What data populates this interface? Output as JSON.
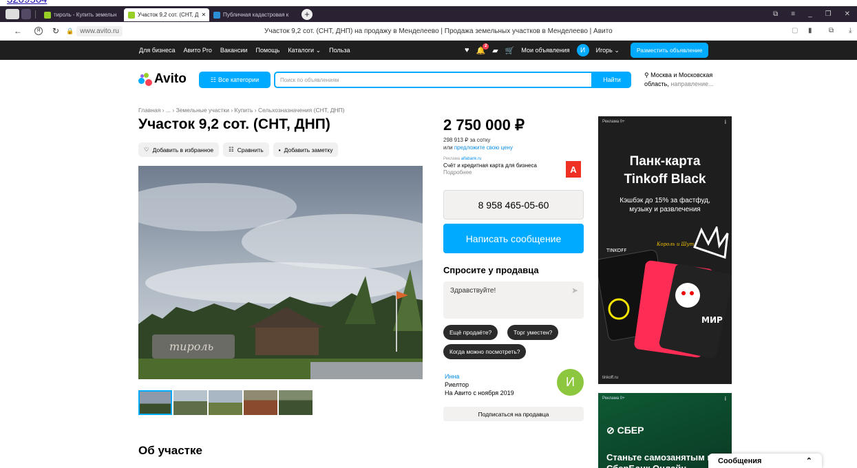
{
  "page_link": "3209564",
  "browser": {
    "tabs": [
      {
        "label": "тироль - Купить земельн",
        "active": false
      },
      {
        "label": "Участок 9,2 сот. (СНТ, Д",
        "active": true
      },
      {
        "label": "Публичная кадастровая к",
        "active": false
      }
    ],
    "url": "www.avito.ru",
    "page_title": "Участок 9,2 сот. (СНТ, ДНП) на продажу в Менделеево | Продажа земельных участков в Менделеево | Авито"
  },
  "site_nav": {
    "links": [
      "Для бизнеса",
      "Авито Pro",
      "Вакансии",
      "Помощь",
      "Каталоги",
      "Польза"
    ],
    "my_ads": "Мои объявления",
    "user_initial": "И",
    "user_name": "Игорь",
    "notifications_count": "2",
    "post_button": "Разместить объявление"
  },
  "header": {
    "logo": "Avito",
    "categories_button": "Все категории",
    "search_placeholder": "Поиск по объявлениям",
    "search_button": "Найти",
    "location": "Москва и Московская область,",
    "direction": "направление..."
  },
  "listing": {
    "breadcrumbs": "Главная › ... › Земельные участки › Купить › Сельхозназначения (СНТ, ДНП)",
    "title": "Участок 9,2 сот. (СНТ, ДНП)",
    "actions": [
      "Добавить в избранное",
      "Сравнить",
      "Добавить заметку"
    ],
    "section_about": "Об участке",
    "thumbnails_count": 5
  },
  "sidebar": {
    "price": "2 750 000 ₽",
    "price_per_unit": "298 913 ₽ за сотку",
    "offer_prefix": "или",
    "offer_link": "предложите свою цену",
    "ad_label": "Реклама",
    "ad_source": "alfabank.ru",
    "ad_text": "Счёт и кредитная карта для бизнеса",
    "ad_more": "Подробнее",
    "ad_logo": "А",
    "phone": "8 958 465-05-60",
    "write_button": "Написать сообщение",
    "ask_title": "Спросите у продавца",
    "ask_placeholder": "Здравствуйте!",
    "quick_questions": [
      "Ещё продаёте?",
      "Торг уместен?",
      "Когда можно посмотреть?"
    ],
    "seller_name": "Инна",
    "seller_role": "Риелтор",
    "seller_since": "На Авито с ноября 2019",
    "seller_initial": "И",
    "subscribe_button": "Подписаться на продавца"
  },
  "banners": {
    "b1_label": "Реклама  0+",
    "b1_title_1": "Панк-карта",
    "b1_title_2": "Tinkoff Black",
    "b1_sub_1": "Кэшбэк до 15% за фастфуд,",
    "b1_sub_2": "музыку и развлечения",
    "b1_card_brand": "TINKOFF",
    "b1_band": "Король и Шут",
    "b1_pay": "МИР",
    "b1_foot": "tinkoff.ru",
    "b2_label": "Реклама  0+",
    "b2_brand": "СБЕР",
    "b2_text": "Станьте самозанятым в СберБанк Онлайн"
  },
  "messages_panel": {
    "label": "Сообщения"
  },
  "colors": {
    "accent": "#00aaff",
    "nav": "#1f1f1f",
    "seller_avatar": "#8dc63f",
    "alfa": "#ef3124"
  }
}
